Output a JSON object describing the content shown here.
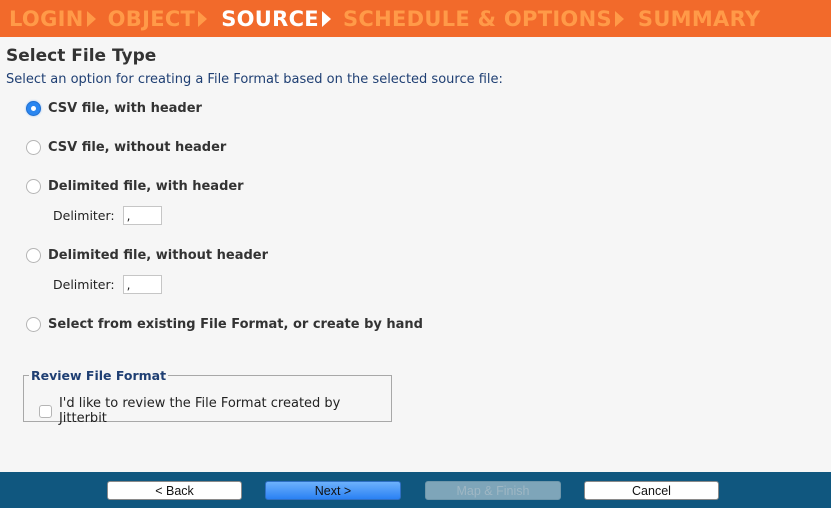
{
  "wizard": {
    "steps": [
      {
        "label": "LOGIN",
        "active": false
      },
      {
        "label": "OBJECT",
        "active": false
      },
      {
        "label": "SOURCE",
        "active": true
      },
      {
        "label": "SCHEDULE & OPTIONS",
        "active": false
      },
      {
        "label": "SUMMARY",
        "active": false
      }
    ]
  },
  "page": {
    "title": "Select File Type",
    "subtitle": "Select an option for creating a File Format based on the selected source file:"
  },
  "options": [
    {
      "label": "CSV file, with header",
      "selected": true
    },
    {
      "label": "CSV file, without header",
      "selected": false
    },
    {
      "label": "Delimited file, with header",
      "selected": false,
      "delimiter_label": "Delimiter:",
      "delimiter_value": ","
    },
    {
      "label": "Delimited file, without header",
      "selected": false,
      "delimiter_label": "Delimiter:",
      "delimiter_value": ","
    },
    {
      "label": "Select from existing File Format, or create by hand",
      "selected": false
    }
  ],
  "review": {
    "legend": "Review File Format",
    "checkbox_label": "I'd like to review the File Format created by Jitterbit",
    "checked": false
  },
  "footer": {
    "back_label": "< Back",
    "next_label": "Next >",
    "map_finish_label": "Map & Finish",
    "cancel_label": "Cancel"
  },
  "colors": {
    "header_bg": "#f26a2b",
    "footer_bg": "#10577f",
    "accent": "#2a86f0"
  }
}
